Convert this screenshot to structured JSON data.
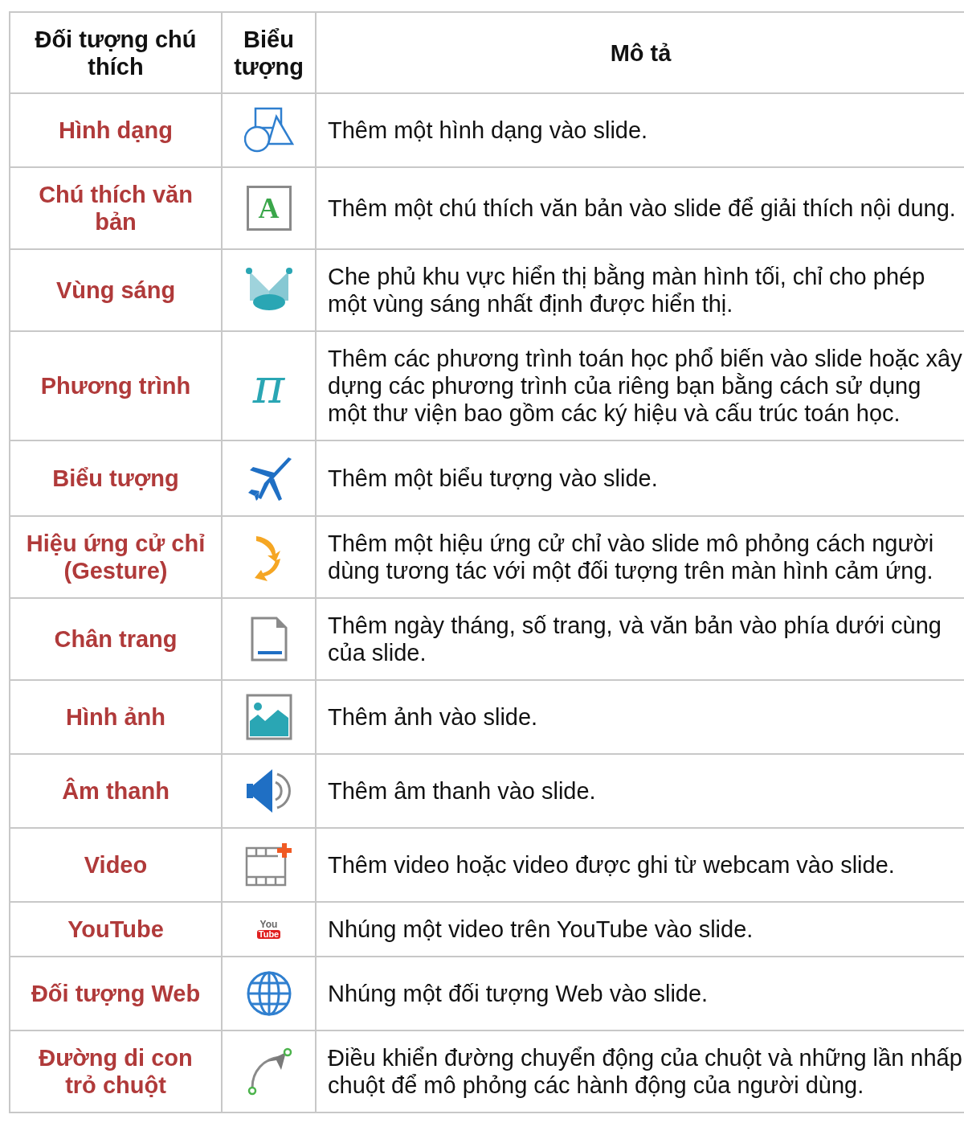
{
  "table": {
    "columns": [
      "Đối tượng chú thích",
      "Biểu tượng",
      "Mô tả"
    ],
    "rows": [
      {
        "name": "Hình dạng",
        "description": "Thêm một hình dạng vào slide."
      },
      {
        "name": "Chú thích văn bản",
        "icon_text": [
          "A"
        ],
        "description": "Thêm một chú thích văn bản vào slide để giải thích nội dung."
      },
      {
        "name": "Vùng sáng",
        "description": "Che phủ khu vực hiển thị bằng màn hình tối, chỉ cho phép một vùng sáng nhất định được hiển thị."
      },
      {
        "name": "Phương trình",
        "icon_text": [
          "π"
        ],
        "description": "Thêm các phương trình toán học phổ biến vào slide hoặc xây dựng các phương trình của riêng bạn bằng cách sử dụng một thư viện bao gồm các ký hiệu và cấu trúc toán học."
      },
      {
        "name": "Biểu tượng",
        "description": "Thêm một biểu tượng vào slide."
      },
      {
        "name": "Hiệu ứng cử chỉ (Gesture)",
        "description": "Thêm một hiệu ứng cử chỉ vào slide mô phỏng cách người dùng tương tác với một đối tượng trên màn hình cảm ứng."
      },
      {
        "name": "Chân trang",
        "description": "Thêm ngày tháng, số trang, và văn bản vào phía dưới cùng của slide."
      },
      {
        "name": "Hình ảnh",
        "description": "Thêm ảnh vào slide."
      },
      {
        "name": "Âm thanh",
        "description": "Thêm âm thanh vào slide."
      },
      {
        "name": "Video",
        "description": "Thêm video hoặc video được ghi từ webcam vào slide."
      },
      {
        "name": "YouTube",
        "icon_text": [
          "You",
          "Tube"
        ],
        "description": "Nhúng một video trên YouTube vào slide."
      },
      {
        "name": "Đối tượng Web",
        "description": "Nhúng một đối tượng Web vào slide."
      },
      {
        "name": "Đường di con trỏ chuột",
        "description": "Điều khiển đường chuyển động của chuột và những lần nhấp chuột để mô phỏng các hành động của người dùng."
      }
    ]
  }
}
